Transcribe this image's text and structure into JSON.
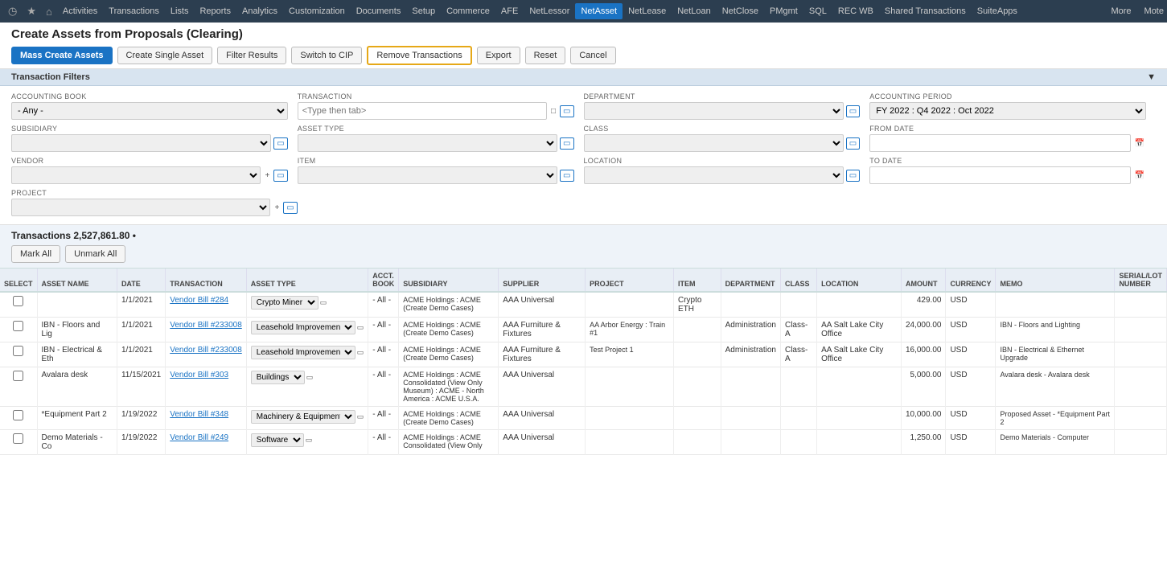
{
  "topNav": {
    "icons": [
      "clock-icon",
      "star-icon",
      "home-icon"
    ],
    "items": [
      {
        "label": "Activities",
        "active": false
      },
      {
        "label": "Transactions",
        "active": false
      },
      {
        "label": "Lists",
        "active": false
      },
      {
        "label": "Reports",
        "active": false
      },
      {
        "label": "Analytics",
        "active": false
      },
      {
        "label": "Customization",
        "active": false
      },
      {
        "label": "Documents",
        "active": false
      },
      {
        "label": "Setup",
        "active": false
      },
      {
        "label": "Commerce",
        "active": false
      },
      {
        "label": "AFE",
        "active": false
      },
      {
        "label": "NetLessor",
        "active": false
      },
      {
        "label": "NetAsset",
        "active": true
      },
      {
        "label": "NetLease",
        "active": false
      },
      {
        "label": "NetLoan",
        "active": false
      },
      {
        "label": "NetClose",
        "active": false
      },
      {
        "label": "PMgmt",
        "active": false
      },
      {
        "label": "SQL",
        "active": false
      },
      {
        "label": "REC WB",
        "active": false
      },
      {
        "label": "Shared Transactions",
        "active": false
      },
      {
        "label": "SuiteApps",
        "active": false
      }
    ],
    "more": "More",
    "mote": "Mote"
  },
  "pageTitle": "Create Assets from Proposals (Clearing)",
  "toolbar": {
    "massCreateAssets": "Mass Create Assets",
    "createSingleAsset": "Create Single Asset",
    "filterResults": "Filter Results",
    "switchToCIP": "Switch to CIP",
    "removeTransactions": "Remove Transactions",
    "export": "Export",
    "reset": "Reset",
    "cancel": "Cancel"
  },
  "sectionHeader": "Transaction Filters",
  "filters": {
    "accountingBook": {
      "label": "ACCOUNTING BOOK",
      "value": "- Any -"
    },
    "transaction": {
      "label": "TRANSACTION",
      "placeholder": "<Type then tab>"
    },
    "department": {
      "label": "DEPARTMENT",
      "value": ""
    },
    "accountingPeriod": {
      "label": "ACCOUNTING PERIOD",
      "value": "FY 2022 : Q4 2022 : Oct 2022"
    },
    "subsidiary": {
      "label": "SUBSIDIARY",
      "value": ""
    },
    "assetType": {
      "label": "ASSET TYPE",
      "value": ""
    },
    "class": {
      "label": "CLASS",
      "value": ""
    },
    "fromDate": {
      "label": "FROM DATE",
      "value": ""
    },
    "vendor": {
      "label": "VENDOR",
      "value": ""
    },
    "item": {
      "label": "ITEM",
      "value": ""
    },
    "location": {
      "label": "LOCATION",
      "value": ""
    },
    "toDate": {
      "label": "TO DATE",
      "value": ""
    },
    "project": {
      "label": "PROJECT",
      "value": ""
    }
  },
  "transactions": {
    "summary": "Transactions 2,527,861.80 •",
    "markAll": "Mark All",
    "unmarkAll": "Unmark All"
  },
  "tableHeaders": [
    "SELECT",
    "ASSET NAME",
    "DATE",
    "TRANSACTION",
    "ASSET TYPE",
    "ACCT. BOOK",
    "SUBSIDIARY",
    "SUPPLIER",
    "PROJECT",
    "ITEM",
    "DEPARTMENT",
    "CLASS",
    "LOCATION",
    "AMOUNT",
    "CURRENCY",
    "MEMO",
    "SERIAL/LOT NUMBER"
  ],
  "tableRows": [
    {
      "assetName": "",
      "date": "1/1/2021",
      "transaction": "Vendor Bill #284",
      "assetType": "Crypto Miner",
      "acctBook": "- All -",
      "subsidiary": "ACME Holdings : ACME (Create Demo Cases)",
      "supplier": "AAA Universal",
      "project": "",
      "item": "Crypto ETH",
      "department": "",
      "class": "",
      "location": "",
      "amount": "429.00",
      "currency": "USD",
      "memo": "",
      "serialLot": ""
    },
    {
      "assetName": "IBN - Floors and Lig",
      "date": "1/1/2021",
      "transaction": "Vendor Bill #233008",
      "assetType": "Leasehold Improvements",
      "acctBook": "- All -",
      "subsidiary": "ACME Holdings : ACME (Create Demo Cases)",
      "supplier": "AAA Furniture & Fixtures",
      "project": "AA Arbor Energy : Train #1",
      "item": "",
      "department": "Administration",
      "class": "Class-A",
      "location": "AA Salt Lake City Office",
      "amount": "24,000.00",
      "currency": "USD",
      "memo": "IBN - Floors and Lighting",
      "serialLot": ""
    },
    {
      "assetName": "IBN - Electrical & Eth",
      "date": "1/1/2021",
      "transaction": "Vendor Bill #233008",
      "assetType": "Leasehold Improvements",
      "acctBook": "- All -",
      "subsidiary": "ACME Holdings : ACME (Create Demo Cases)",
      "supplier": "AAA Furniture & Fixtures",
      "project": "Test Project 1",
      "item": "",
      "department": "Administration",
      "class": "Class-A",
      "location": "AA Salt Lake City Office",
      "amount": "16,000.00",
      "currency": "USD",
      "memo": "IBN - Electrical & Ethernet Upgrade",
      "serialLot": ""
    },
    {
      "assetName": "Avalara desk",
      "date": "11/15/2021",
      "transaction": "Vendor Bill #303",
      "assetType": "Buildings",
      "acctBook": "- All -",
      "subsidiary": "ACME Holdings : ACME Consolidated (View Only Museum) : ACME - North America : ACME U.S.A.",
      "supplier": "AAA Universal",
      "project": "",
      "item": "",
      "department": "",
      "class": "",
      "location": "",
      "amount": "5,000.00",
      "currency": "USD",
      "memo": "Avalara desk - Avalara desk",
      "serialLot": ""
    },
    {
      "assetName": "*Equipment Part 2",
      "date": "1/19/2022",
      "transaction": "Vendor Bill #348",
      "assetType": "Machinery & Equipment",
      "acctBook": "- All -",
      "subsidiary": "ACME Holdings : ACME (Create Demo Cases)",
      "supplier": "AAA Universal",
      "project": "",
      "item": "",
      "department": "",
      "class": "",
      "location": "",
      "amount": "10,000.00",
      "currency": "USD",
      "memo": "Proposed Asset - *Equipment Part 2",
      "serialLot": ""
    },
    {
      "assetName": "Demo Materials - Co",
      "date": "1/19/2022",
      "transaction": "Vendor Bill #249",
      "assetType": "Software",
      "acctBook": "- All -",
      "subsidiary": "ACME Holdings : ACME Consolidated (View Only",
      "supplier": "AAA Universal",
      "project": "",
      "item": "",
      "department": "",
      "class": "",
      "location": "",
      "amount": "1,250.00",
      "currency": "USD",
      "memo": "Demo Materials - Computer",
      "serialLot": ""
    }
  ]
}
